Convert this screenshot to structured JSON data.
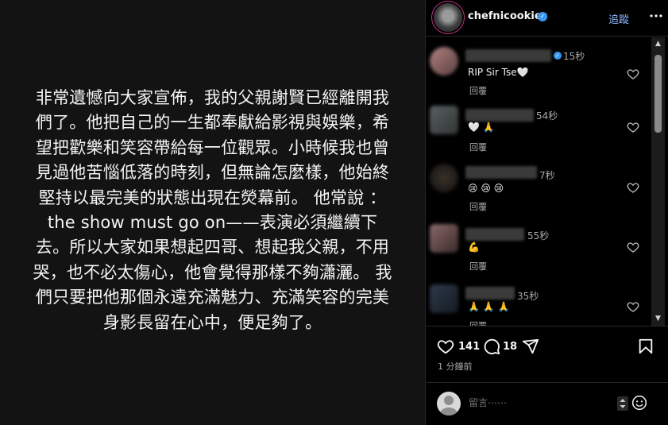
{
  "story": {
    "text": "非常遺憾向大家宣佈，我的父親謝賢已經離開我們了。他把自己的一生都奉獻給影視與娛樂，希望把歡樂和笑容帶給每一位觀眾。小時候我也曾見過他苦惱低落的時刻，但無論怎麼樣，他始終堅持以最完美的狀態出現在熒幕前。 他常說 ：the show must go on——表演必須繼續下去。所以大家如果想起四哥、想起我父親，不用哭，也不必太傷心，他會覺得那樣不夠瀟灑。 我們只要把他那個永遠充滿魅力、充滿笑容的完美身影長留在心中，便足夠了。"
  },
  "header": {
    "username": "chefnicookies",
    "follow_label": "追蹤",
    "icons": {
      "more": "more-icon",
      "verified": "verified-badge-icon"
    }
  },
  "comments": [
    {
      "time": "15秒",
      "text": "RIP Sir Tse🤍",
      "reply": "回覆",
      "verified": true
    },
    {
      "time": "54秒",
      "text": "🤍 🙏",
      "reply": "回覆",
      "verified": false
    },
    {
      "time": "7秒",
      "text": "😢 😢 😢",
      "reply": "回覆",
      "verified": false
    },
    {
      "time": "55秒",
      "text": "💪",
      "reply": "回覆",
      "verified": false
    },
    {
      "time": "35秒",
      "text": "🙏 🙏 🙏",
      "reply": "回覆",
      "verified": false
    }
  ],
  "actions": {
    "likes": "141",
    "comments": "18",
    "time_ago": "1 分鐘前",
    "icons": [
      "heart-icon",
      "comment-icon",
      "share-icon",
      "bookmark-icon"
    ]
  },
  "composer": {
    "placeholder": "留言⋯⋯",
    "icons": [
      "avatar",
      "emoji-icon"
    ]
  },
  "colors": {
    "link": "#8fb8ff",
    "verified": "#3897f0",
    "background": "#000000"
  }
}
